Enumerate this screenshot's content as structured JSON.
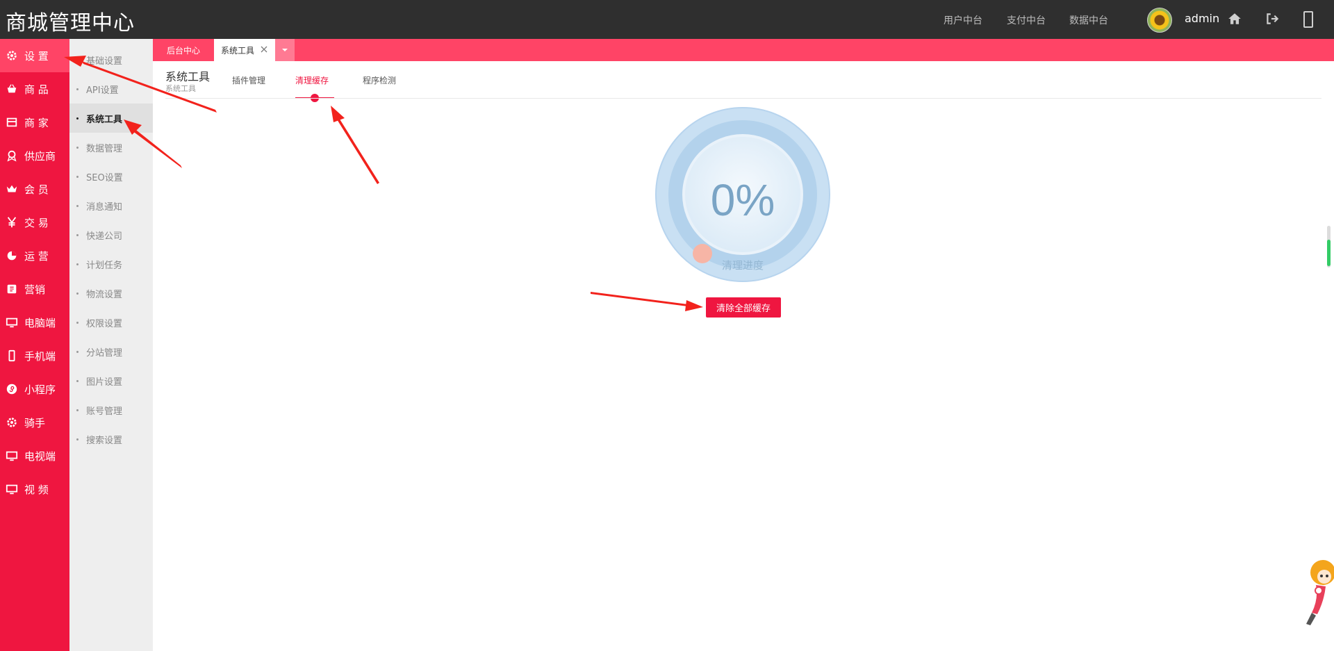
{
  "app": {
    "title": "商城管理中心"
  },
  "topnav": [
    "用户中台",
    "支付中台",
    "数据中台"
  ],
  "user": {
    "name": "admin"
  },
  "sidebar": {
    "items": [
      {
        "label": "设 置",
        "icon": "gear-icon"
      },
      {
        "label": "商 品",
        "icon": "basket-icon"
      },
      {
        "label": "商 家",
        "icon": "store-icon"
      },
      {
        "label": "供应商",
        "icon": "badge-icon"
      },
      {
        "label": "会 员",
        "icon": "crown-icon"
      },
      {
        "label": "交 易",
        "icon": "yen-icon"
      },
      {
        "label": "运 营",
        "icon": "pie-icon"
      },
      {
        "label": "营销",
        "icon": "coupon-icon"
      },
      {
        "label": "电脑端",
        "icon": "monitor-icon"
      },
      {
        "label": "手机端",
        "icon": "phone-icon"
      },
      {
        "label": "小程序",
        "icon": "mini-program-icon"
      },
      {
        "label": "骑手",
        "icon": "gear-icon"
      },
      {
        "label": "电视端",
        "icon": "monitor-icon"
      },
      {
        "label": "视 频",
        "icon": "monitor-icon"
      }
    ]
  },
  "submenu": {
    "items": [
      "基础设置",
      "API设置",
      "系统工具",
      "数据管理",
      "SEO设置",
      "消息通知",
      "快递公司",
      "计划任务",
      "物流设置",
      "权限设置",
      "分站管理",
      "图片设置",
      "账号管理",
      "搜索设置"
    ]
  },
  "tabs": {
    "home": "后台中心",
    "current": "系统工具"
  },
  "page": {
    "title": "系统工具",
    "subtitle": "系统工具",
    "subtabs": [
      "插件管理",
      "清理缓存",
      "程序检测"
    ]
  },
  "progress": {
    "value_text": "0%",
    "value": 0,
    "label": "清理进度"
  },
  "actions": {
    "clear_all": "清除全部缓存"
  },
  "colors": {
    "brand_red": "#ef1640",
    "tab_red": "#ff4466",
    "topbar": "#2f2f2f",
    "ring": "#c5def2"
  }
}
